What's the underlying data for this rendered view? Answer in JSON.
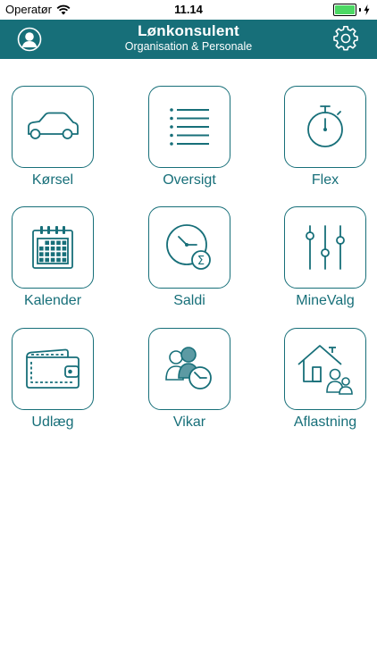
{
  "status_bar": {
    "carrier": "Operatør",
    "time": "11.14",
    "battery_level": 1.0
  },
  "header": {
    "title": "Lønkonsulent",
    "subtitle": "Organisation & Personale"
  },
  "colors": {
    "primary": "#176f79",
    "background": "#ffffff",
    "battery": "#4cd964"
  },
  "tiles": [
    {
      "label": "Kørsel",
      "icon": "car-icon"
    },
    {
      "label": "Oversigt",
      "icon": "list-icon"
    },
    {
      "label": "Flex",
      "icon": "stopwatch-icon"
    },
    {
      "label": "Kalender",
      "icon": "calendar-icon"
    },
    {
      "label": "Saldi",
      "icon": "clock-sum-icon"
    },
    {
      "label": "MineValg",
      "icon": "sliders-icon"
    },
    {
      "label": "Udlæg",
      "icon": "wallet-icon"
    },
    {
      "label": "Vikar",
      "icon": "people-clock-icon"
    },
    {
      "label": "Aflastning",
      "icon": "house-family-icon"
    }
  ]
}
